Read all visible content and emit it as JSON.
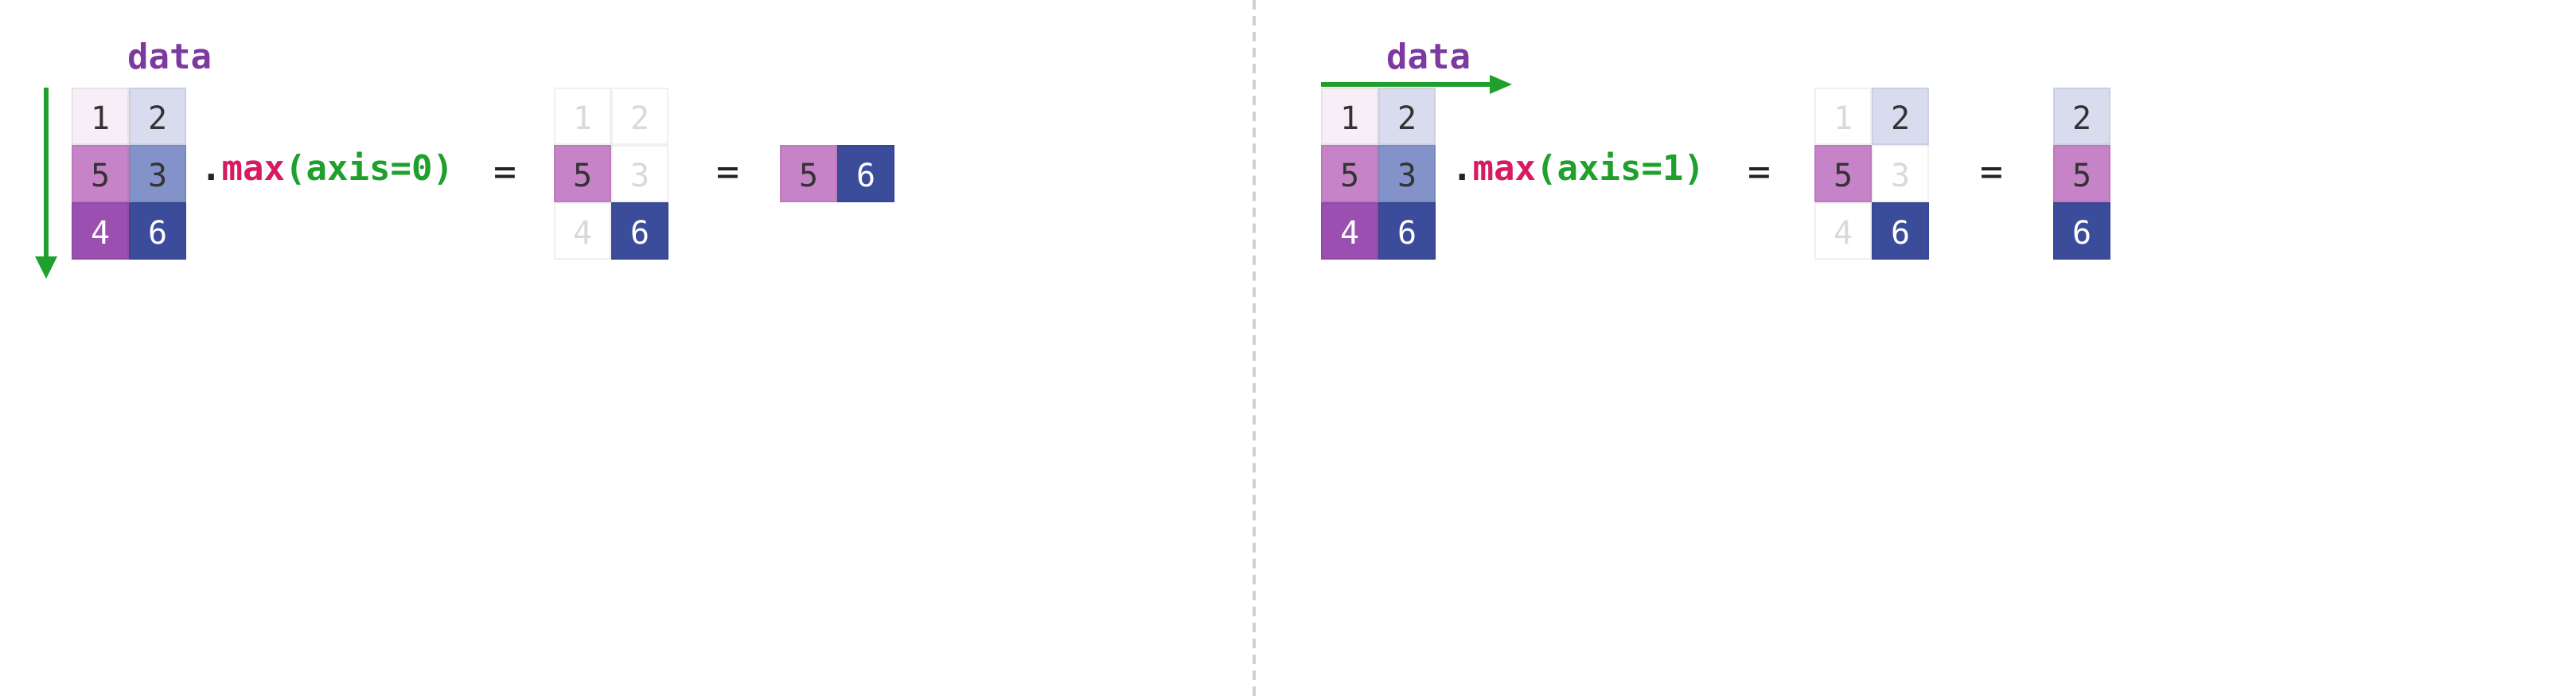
{
  "left": {
    "label": "data",
    "expr": {
      "dot": ".",
      "func": "max",
      "open": "(",
      "arg": "axis=0",
      "close": ")"
    },
    "eq1": "=",
    "eq2": "=",
    "data_matrix": [
      [
        1,
        2
      ],
      [
        5,
        3
      ],
      [
        4,
        6
      ]
    ],
    "step_matrix": [
      [
        1,
        2
      ],
      [
        5,
        3
      ],
      [
        4,
        6
      ]
    ],
    "step_active": [
      [
        false,
        false
      ],
      [
        true,
        false
      ],
      [
        false,
        true
      ]
    ],
    "result": [
      5,
      6
    ]
  },
  "right": {
    "label": "data",
    "expr": {
      "dot": ".",
      "func": "max",
      "open": "(",
      "arg": "axis=1",
      "close": ")"
    },
    "eq1": "=",
    "eq2": "=",
    "data_matrix": [
      [
        1,
        2
      ],
      [
        5,
        3
      ],
      [
        4,
        6
      ]
    ],
    "step_matrix": [
      [
        1,
        2
      ],
      [
        5,
        3
      ],
      [
        4,
        6
      ]
    ],
    "step_active": [
      [
        false,
        true
      ],
      [
        true,
        false
      ],
      [
        false,
        true
      ]
    ],
    "result": [
      2,
      5,
      6
    ]
  },
  "colors": {
    "col0": [
      "bg-pink-vlight dark-text",
      "bg-purple-mid dark-text",
      "bg-purple-dark light-text"
    ],
    "col1": [
      "bg-blue-vlight dark-text",
      "bg-blue-mid dark-text",
      "bg-blue-dark light-text"
    ],
    "result_left": [
      "bg-purple-mid dark-text",
      "bg-blue-dark light-text"
    ],
    "result_right": [
      "bg-blue-vlight dark-text",
      "bg-purple-mid dark-text",
      "bg-blue-dark light-text"
    ]
  }
}
